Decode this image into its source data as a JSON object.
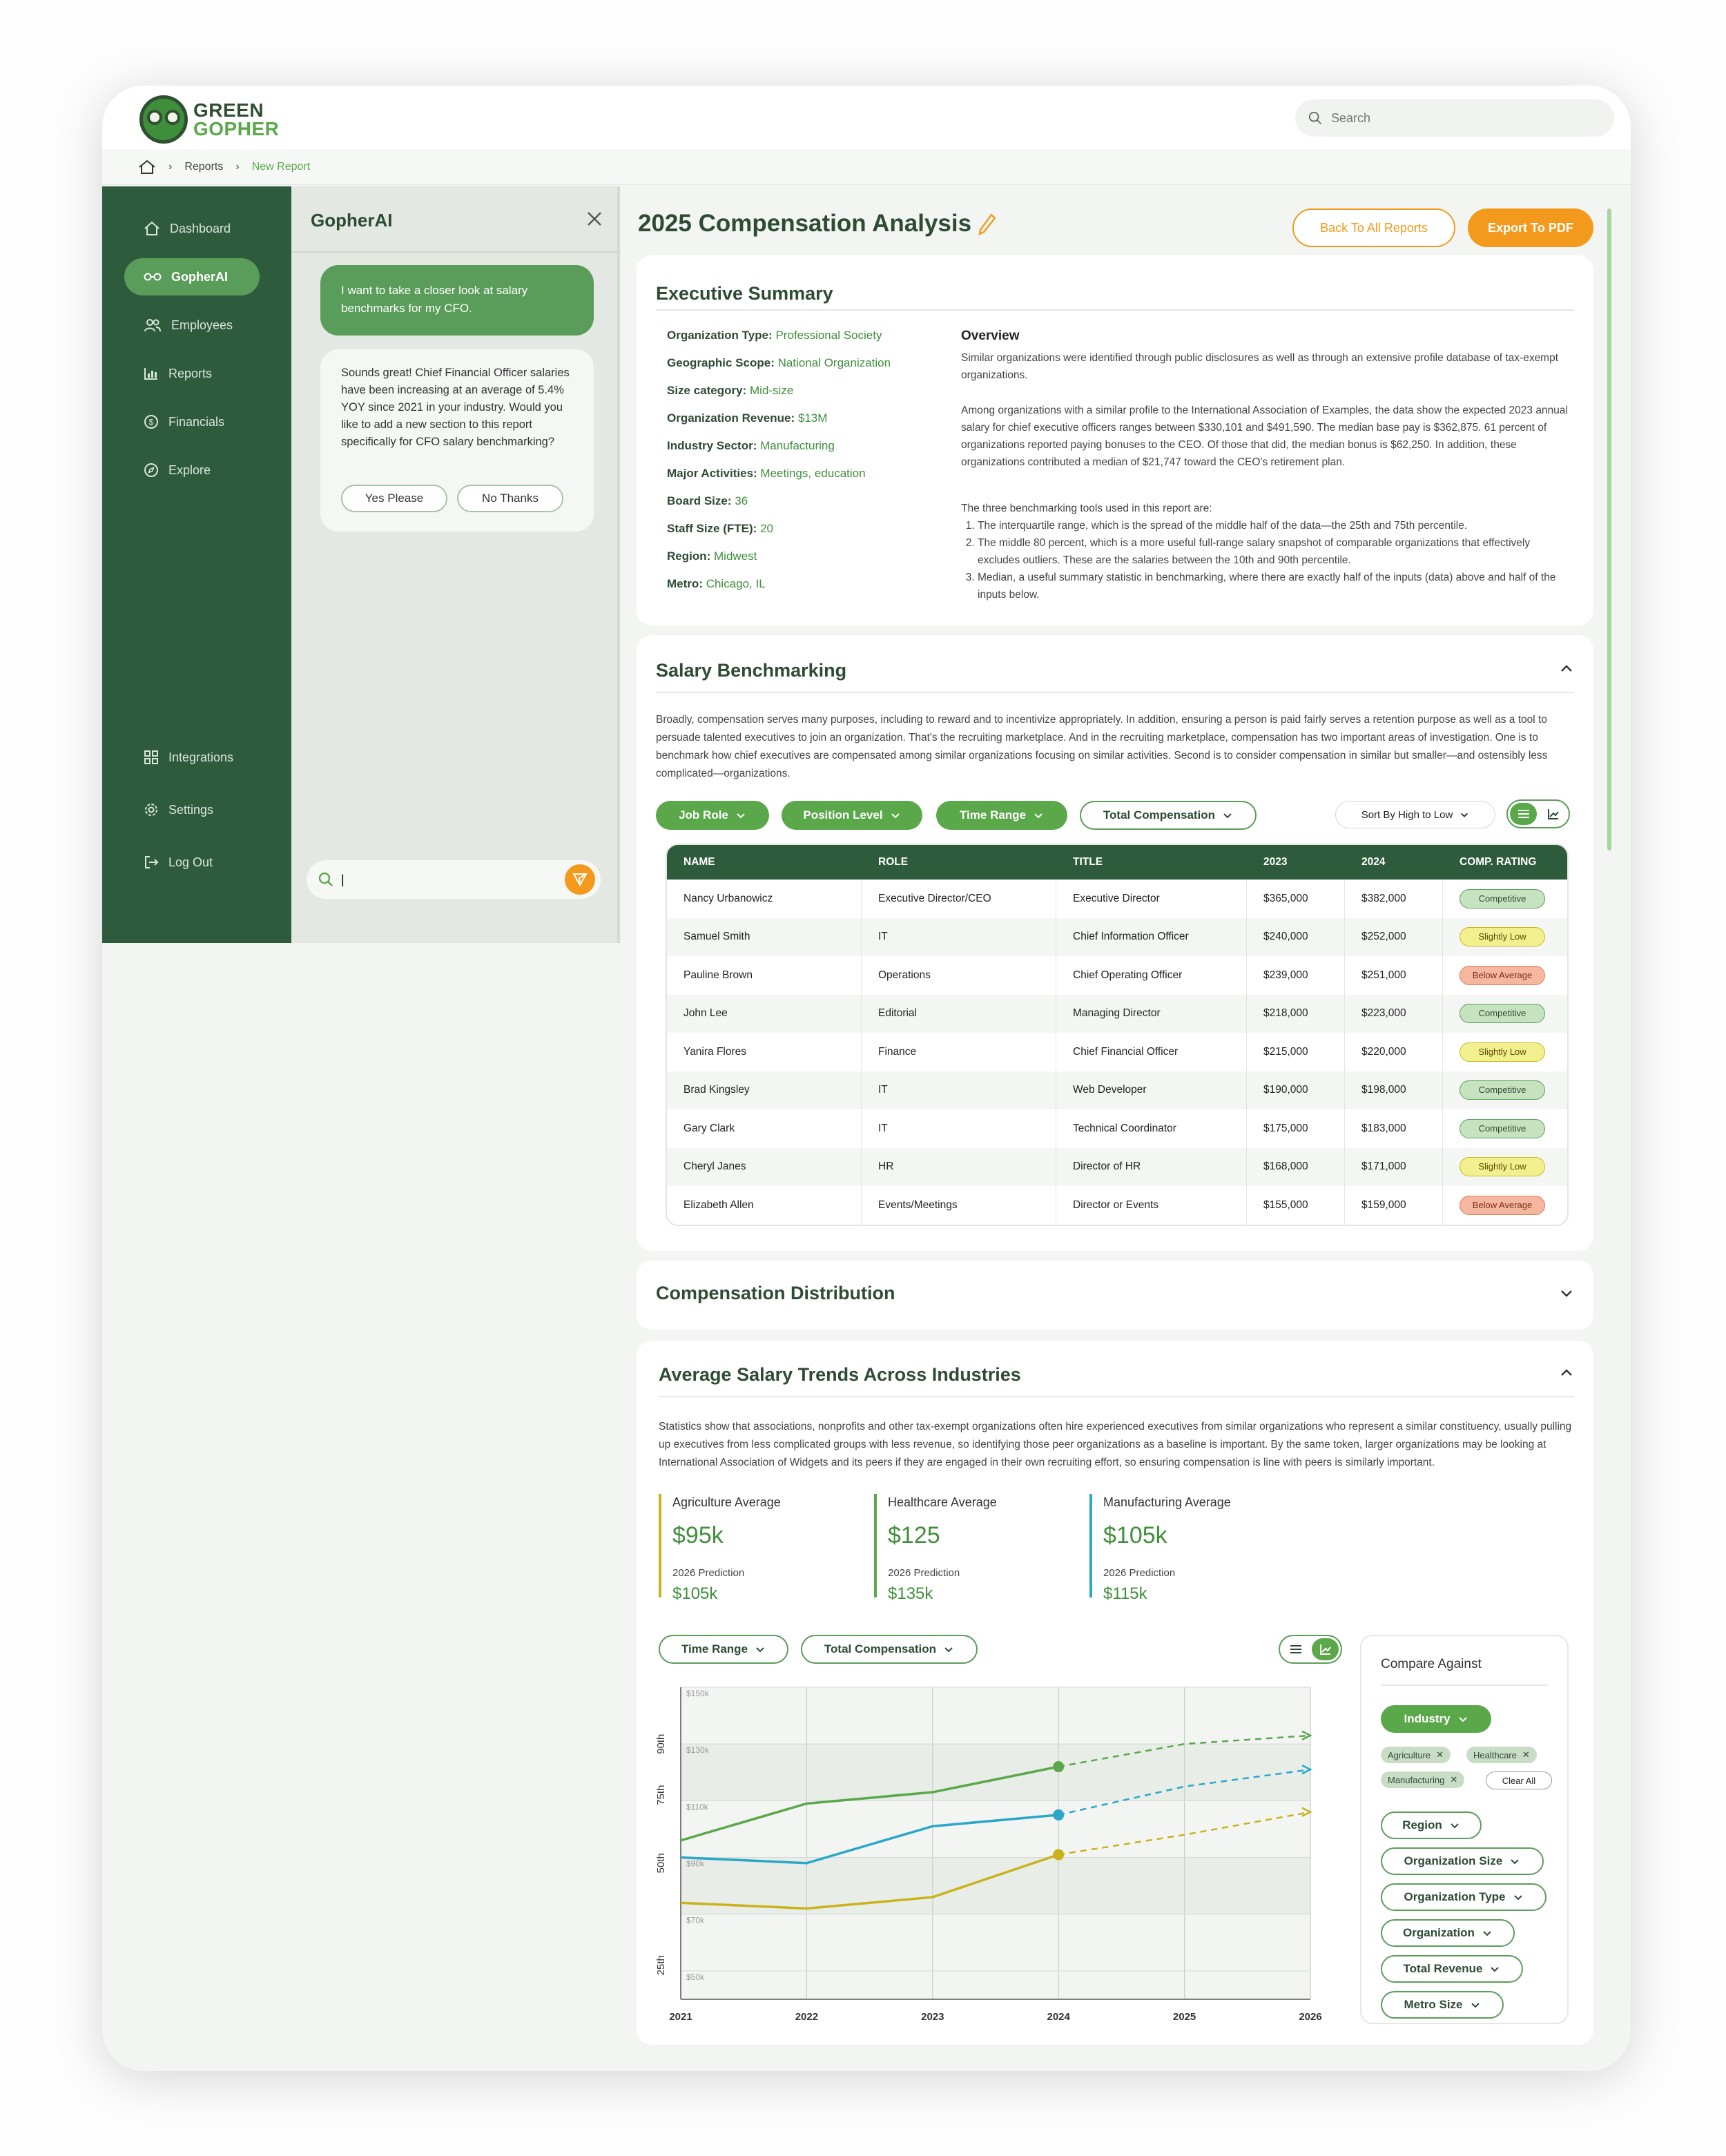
{
  "brand": {
    "line1": "GREEN",
    "line2": "GOPHER"
  },
  "search": {
    "placeholder": "Search"
  },
  "breadcrumb": {
    "items": [
      "Reports",
      "New Report"
    ]
  },
  "sidebar": {
    "items": [
      "Dashboard",
      "GopherAI",
      "Employees",
      "Reports",
      "Financials",
      "Explore"
    ],
    "bottom_items": [
      "Integrations",
      "Settings",
      "Log Out"
    ]
  },
  "ai": {
    "title": "GopherAI",
    "user_message": "I want to take a closer look at salary benchmarks for my CFO.",
    "ai_message": "Sounds great! Chief Financial Officer salaries have been increasing at an average of 5.4% YOY since 2021 in your industry. Would you like to add a new section to this report specifically for CFO salary benchmarking?",
    "yes_label": "Yes Please",
    "no_label": "No Thanks",
    "input_value": "|"
  },
  "page": {
    "title": "2025 Compensation Analysis",
    "back_label": "Back To All Reports",
    "export_label": "Export To PDF"
  },
  "exec": {
    "title": "Executive Summary",
    "facts": [
      {
        "k": "Organization Type:",
        "v": "Professional Society"
      },
      {
        "k": "Geographic Scope:",
        "v": "National Organization"
      },
      {
        "k": "Size category:",
        "v": "Mid-size"
      },
      {
        "k": "Organization Revenue:",
        "v": "$13M"
      },
      {
        "k": "Industry Sector:",
        "v": "Manufacturing"
      },
      {
        "k": "Major Activities:",
        "v": "Meetings, education"
      },
      {
        "k": "Board Size:",
        "v": "36"
      },
      {
        "k": "Staff Size (FTE):",
        "v": "20"
      },
      {
        "k": "Region:",
        "v": "Midwest"
      },
      {
        "k": "Metro:",
        "v": "Chicago, IL"
      }
    ],
    "overview_title": "Overview",
    "overview_p1": "Similar organizations were identified through public disclosures as well as through an extensive profile database of tax-exempt organizations.",
    "overview_p2": "Among organizations with a similar profile to the International Association of Examples, the data show the expected 2023 annual salary for chief executive officers ranges between $330,101 and $491,590. The median base pay is $362,875. 61 percent of organizations reported paying bonuses to the CEO. Of those that did, the median bonus is $62,250. In addition, these organizations contributed a median of $21,747 toward the CEO's retirement plan.",
    "overview_p3": "The three benchmarking tools used in this report are:",
    "overview_list": [
      "The interquartile range, which is the spread of the middle half of the data—the 25th and 75th percentile.",
      "The middle 80 percent, which is a more useful full-range salary snapshot of comparable organizations that effectively excludes outliers. These are the salaries between the 10th and 90th percentile.",
      "Median, a useful summary statistic in benchmarking, where there are exactly half of the inputs (data) above and half of the inputs below."
    ]
  },
  "bench": {
    "title": "Salary Benchmarking",
    "intro": "Broadly, compensation serves many purposes, including to reward and to incentivize appropriately. In addition, ensuring a person is paid fairly serves a retention purpose as well as a tool to persuade talented executives to join an organization. That's the recruiting marketplace. And in the recruiting marketplace, compensation has two important areas of investigation. One is to benchmark how chief executives are compensated among similar organizations focusing on similar activities. Second is to consider compensation in similar but smaller—and ostensibly less complicated—organizations.",
    "filters": [
      "Job Role",
      "Position Level",
      "Time Range",
      "Total Compensation"
    ],
    "sort_label": "Sort By",
    "sort_value": "High to Low",
    "columns": [
      "NAME",
      "ROLE",
      "TITLE",
      "2023",
      "2024",
      "COMP. RATING"
    ],
    "rows": [
      {
        "name": "Nancy Urbanowicz",
        "role": "Executive Director/CEO",
        "title": "Executive Director",
        "y2023": "$365,000",
        "y2024": "$382,000",
        "rating": "Competitive",
        "cls": "comp"
      },
      {
        "name": "Samuel Smith",
        "role": "IT",
        "title": "Chief Information Officer",
        "y2023": "$240,000",
        "y2024": "$252,000",
        "rating": "Slightly Low",
        "cls": "slight"
      },
      {
        "name": "Pauline Brown",
        "role": "Operations",
        "title": "Chief Operating Officer",
        "y2023": "$239,000",
        "y2024": "$251,000",
        "rating": "Below Average",
        "cls": "below"
      },
      {
        "name": "John Lee",
        "role": "Editorial",
        "title": "Managing Director",
        "y2023": "$218,000",
        "y2024": "$223,000",
        "rating": "Competitive",
        "cls": "comp"
      },
      {
        "name": "Yanira Flores",
        "role": "Finance",
        "title": "Chief Financial Officer",
        "y2023": "$215,000",
        "y2024": "$220,000",
        "rating": "Slightly Low",
        "cls": "slight"
      },
      {
        "name": "Brad Kingsley",
        "role": "IT",
        "title": "Web Developer",
        "y2023": "$190,000",
        "y2024": "$198,000",
        "rating": "Competitive",
        "cls": "comp"
      },
      {
        "name": "Gary Clark",
        "role": "IT",
        "title": "Technical Coordinator",
        "y2023": "$175,000",
        "y2024": "$183,000",
        "rating": "Competitive",
        "cls": "comp"
      },
      {
        "name": "Cheryl Janes",
        "role": "HR",
        "title": "Director of HR",
        "y2023": "$168,000",
        "y2024": "$171,000",
        "rating": "Slightly Low",
        "cls": "slight"
      },
      {
        "name": "Elizabeth Allen",
        "role": "Events/Meetings",
        "title": "Director or Events",
        "y2023": "$155,000",
        "y2024": "$159,000",
        "rating": "Below Average",
        "cls": "below"
      }
    ]
  },
  "dist": {
    "title": "Compensation Distribution"
  },
  "trends": {
    "title": "Average Salary Trends Across Industries",
    "intro": "Statistics show that associations, nonprofits and other tax-exempt organizations often hire experienced executives from similar organizations who represent a similar constituency, usually pulling up executives from less complicated groups with less revenue, so identifying those peer organizations as a baseline is important. By the same token, larger organizations may be looking at International Association of Widgets and its peers if they are engaged in their own recruiting effort, so ensuring compensation is line with peers is similarly important.",
    "stats": [
      {
        "label": "Agriculture Average",
        "value": "$95k",
        "pred_label": "2026 Prediction",
        "pred": "$105k",
        "color": "#c9b21a"
      },
      {
        "label": "Healthcare Average",
        "value": "$125",
        "pred_label": "2026 Prediction",
        "pred": "$135k",
        "color": "#5aa84a"
      },
      {
        "label": "Manufacturing Average",
        "value": "$105k",
        "pred_label": "2026 Prediction",
        "pred": "$115k",
        "color": "#2aa7c9"
      }
    ],
    "filters": [
      "Time Range",
      "Total Compensation"
    ],
    "compare": {
      "title": "Compare Against",
      "industry_label": "Industry",
      "tags": [
        "Agriculture",
        "Healthcare",
        "Manufacturing"
      ],
      "clear_label": "Clear All",
      "dropdowns": [
        "Region",
        "Organization Size",
        "Organization Type",
        "Organization",
        "Total Revenue",
        "Metro Size"
      ]
    }
  },
  "chart_data": {
    "type": "line",
    "x": [
      "2021",
      "2022",
      "2023",
      "2024",
      "2025",
      "2026"
    ],
    "y_ticks": [
      "$150k",
      "$130k",
      "$110k",
      "$90k",
      "$70k",
      "$50k"
    ],
    "band_labels": [
      "90th",
      "75th",
      "50th",
      "25th"
    ],
    "ylim": [
      40,
      150
    ],
    "forecast_from": "2024",
    "series": [
      {
        "name": "Healthcare",
        "color": "#5aa84a",
        "values": [
          96,
          109,
          113,
          122,
          130,
          133
        ]
      },
      {
        "name": "Manufacturing",
        "color": "#2aa7c9",
        "values": [
          90,
          88,
          101,
          105,
          115,
          121
        ]
      },
      {
        "name": "Agriculture",
        "color": "#c9b21a",
        "values": [
          74,
          72,
          76,
          91,
          98,
          106
        ]
      }
    ]
  }
}
